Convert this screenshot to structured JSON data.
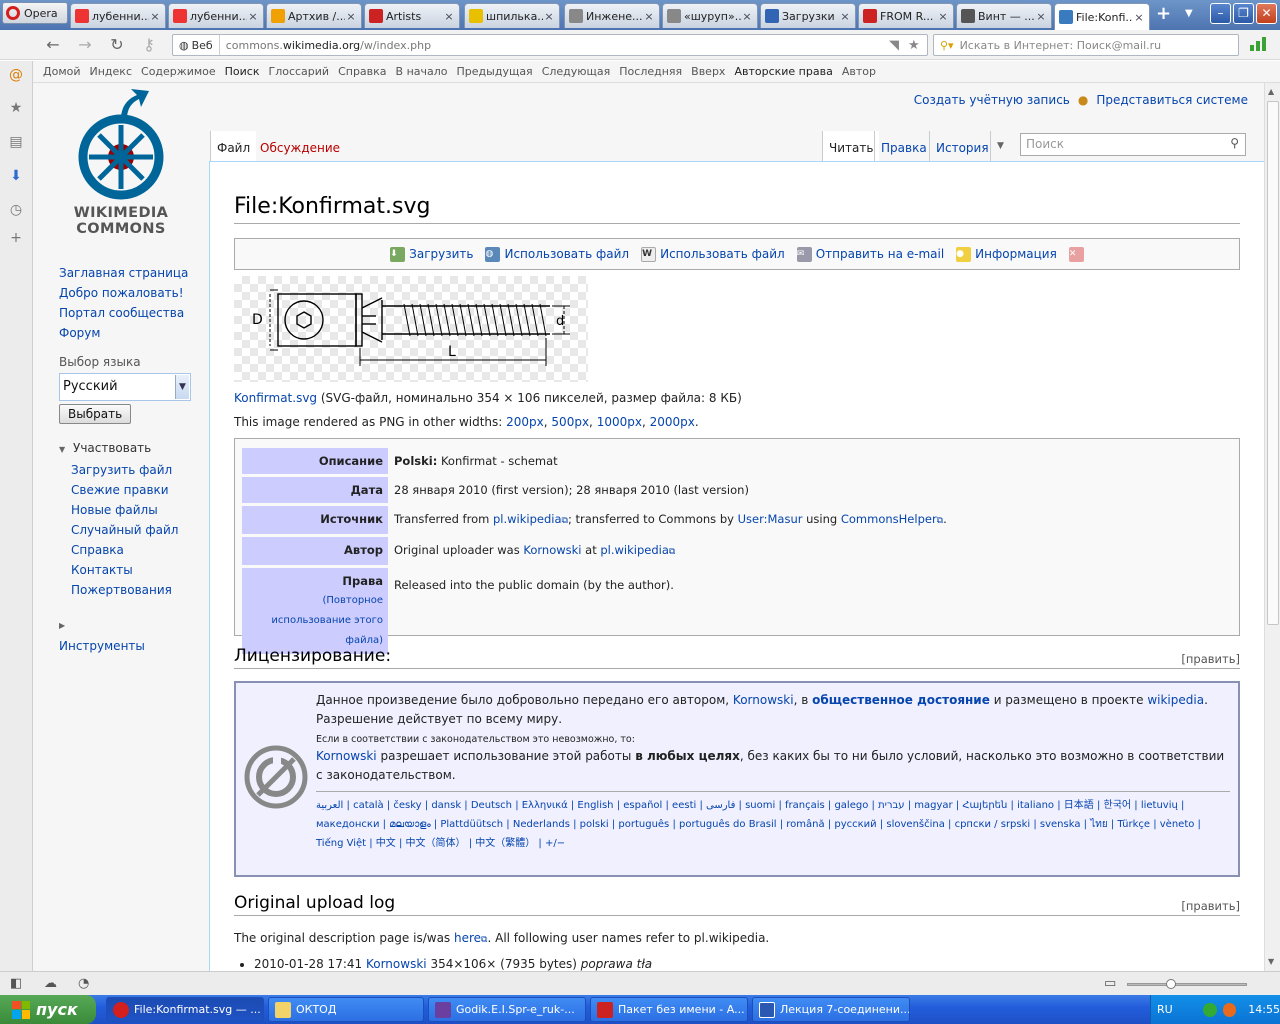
{
  "browser": {
    "menu_label": "Opera",
    "tabs": [
      {
        "label": "лубенни...",
        "icon": "yandex",
        "color": "#e33"
      },
      {
        "label": "лубенни...",
        "icon": "yandex",
        "color": "#e33"
      },
      {
        "label": "Артхив /...",
        "icon": "arthive",
        "color": "#f0a000"
      },
      {
        "label": "Artists",
        "icon": "artists",
        "color": "#c22"
      },
      {
        "label": "шпилька...",
        "icon": "page",
        "color": "#e8c000"
      },
      {
        "label": "Инжене...",
        "icon": "page",
        "color": "#888"
      },
      {
        "label": "«шуруп»...",
        "icon": "page",
        "color": "#888"
      },
      {
        "label": "Загрузки",
        "icon": "downloads",
        "color": "#3264b4"
      },
      {
        "label": "FROM R...",
        "icon": "artists",
        "color": "#c22"
      },
      {
        "label": "Винт — ...",
        "icon": "wikipedia",
        "color": "#555"
      },
      {
        "label": "File:Konfi...",
        "icon": "commons",
        "color": "#3a7abf",
        "active": true
      }
    ],
    "address": {
      "badge": "Веб",
      "url_prefix": "commons.",
      "url_domain": "wikimedia.org",
      "url_path": "/w/index.php"
    },
    "search_placeholder": "Искать в Интернет: Поиск@mail.ru",
    "bookmarks": [
      "Домой",
      "Индекс",
      "Содержимое",
      "Поиск",
      "Глоссарий",
      "Справка",
      "В начало",
      "Предыдущая",
      "Следующая",
      "Последняя",
      "Вверх",
      "Авторские права",
      "Автор"
    ]
  },
  "wiki": {
    "personal": {
      "create_account": "Создать учётную запись",
      "login": "Представиться системе"
    },
    "logo_text": [
      "WIKIMEDIA",
      "COMMONS"
    ],
    "nav": [
      "Заглавная страница",
      "Добро пожаловать!",
      "Портал сообщества",
      "Форум"
    ],
    "lang_heading": "Выбор языка",
    "lang_value": "Русский",
    "lang_button": "Выбрать",
    "participate_heading": "Участвовать",
    "participate": [
      "Загрузить файл",
      "Свежие правки",
      "Новые файлы",
      "Случайный файл",
      "Справка",
      "Контакты",
      "Пожертвования"
    ],
    "tools_heading": "Инструменты",
    "tabs": {
      "file": "Файл",
      "talk": "Обсуждение",
      "read": "Читать",
      "edit": "Правка",
      "history": "История",
      "search_placeholder": "Поиск"
    },
    "title": "File:Konfirmat.svg",
    "actions": [
      "Загрузить",
      "Использовать файл",
      "Использовать файл",
      "Отправить на e-mail",
      "Информация"
    ],
    "diagram_labels": {
      "D": "D",
      "d": "d",
      "L": "L"
    },
    "file_link": "Konfirmat.svg",
    "file_meta": "(SVG-файл, номинально 354 × 106 пикселей, размер файла: 8 КБ)",
    "rendered_prefix": "This image rendered as PNG in other widths:",
    "widths": [
      "200px",
      "500px",
      "1000px",
      "2000px"
    ],
    "info": {
      "desc_label": "Описание",
      "desc_lang": "Polski:",
      "desc_text": "Konfirmat - schemat",
      "date_label": "Дата",
      "date_text": "28 января 2010 (first version); 28 января 2010 (last version)",
      "source_label": "Источник",
      "source_pre": "Transferred from",
      "source_link1": "pl.wikipedia",
      "source_mid": "; transferred to Commons by",
      "source_user": "User:Masur",
      "source_using": "using",
      "source_tool": "CommonsHelper",
      "author_label": "Автор",
      "author_pre": "Original uploader was",
      "author_user": "Kornowski",
      "author_at": "at",
      "author_wiki": "pl.wikipedia",
      "rights_label": "Права",
      "rights_sub": "(Повторное использование этого файла)",
      "rights_text": "Released into the public domain (by the author)."
    },
    "license_heading": "Лицензирование:",
    "edit_link": "[править]",
    "license": {
      "p1_a": "Данное произведение было добровольно передано его автором,",
      "p1_user": "Kornowski",
      "p1_b": ", в",
      "p1_pd": "общественное достояние",
      "p1_c": "и размещено в проекте",
      "p1_wiki": "wikipedia",
      "p1_d": ". Разрешение действует по всему миру.",
      "note": "Если в соответствии с законодательством это невозможно, то:",
      "p2_user": "Kornowski",
      "p2_a": "разрешает использование этой работы",
      "p2_b": "в любых целях",
      "p2_c": ", без каких бы то ни было условий, насколько это возможно в соответствии с законодательством.",
      "languages": "العربية | català | česky | dansk | Deutsch | Ελληνικά | English | español | eesti | فارسی | suomi | français | galego | עברית | magyar | Հայերեն | italiano | 日本語 | 한국어 | lietuvių | македонски | മലയാളം | Plattdüütsch | Nederlands | polski | português | português do Brasil | română | русский | slovenščina | српски / srpski | svenska | ไทย | Türkçe | vèneto | Tiếng Việt | 中文 | 中文（简体） | 中文（繁體） | +/−"
    },
    "log_heading": "Original upload log",
    "log_intro_a": "The original description page is/was",
    "log_here": "here",
    "log_intro_b": ". All following user names refer to pl.wikipedia.",
    "log_items": [
      {
        "date": "2010-01-28 17:41",
        "user": "Kornowski",
        "meta": "354×106× (7935 bytes)",
        "comment": "poprawa tła"
      }
    ]
  },
  "taskbar": {
    "start": "пуск",
    "items": [
      "File:Konfirmat.svg — ...",
      "ОКТОД",
      "Godik.E.I.Spr-e_ruk-...",
      "Пакет без имени - A...",
      "Лекция 7-соединени..."
    ],
    "lang": "RU",
    "time": "14:55"
  }
}
